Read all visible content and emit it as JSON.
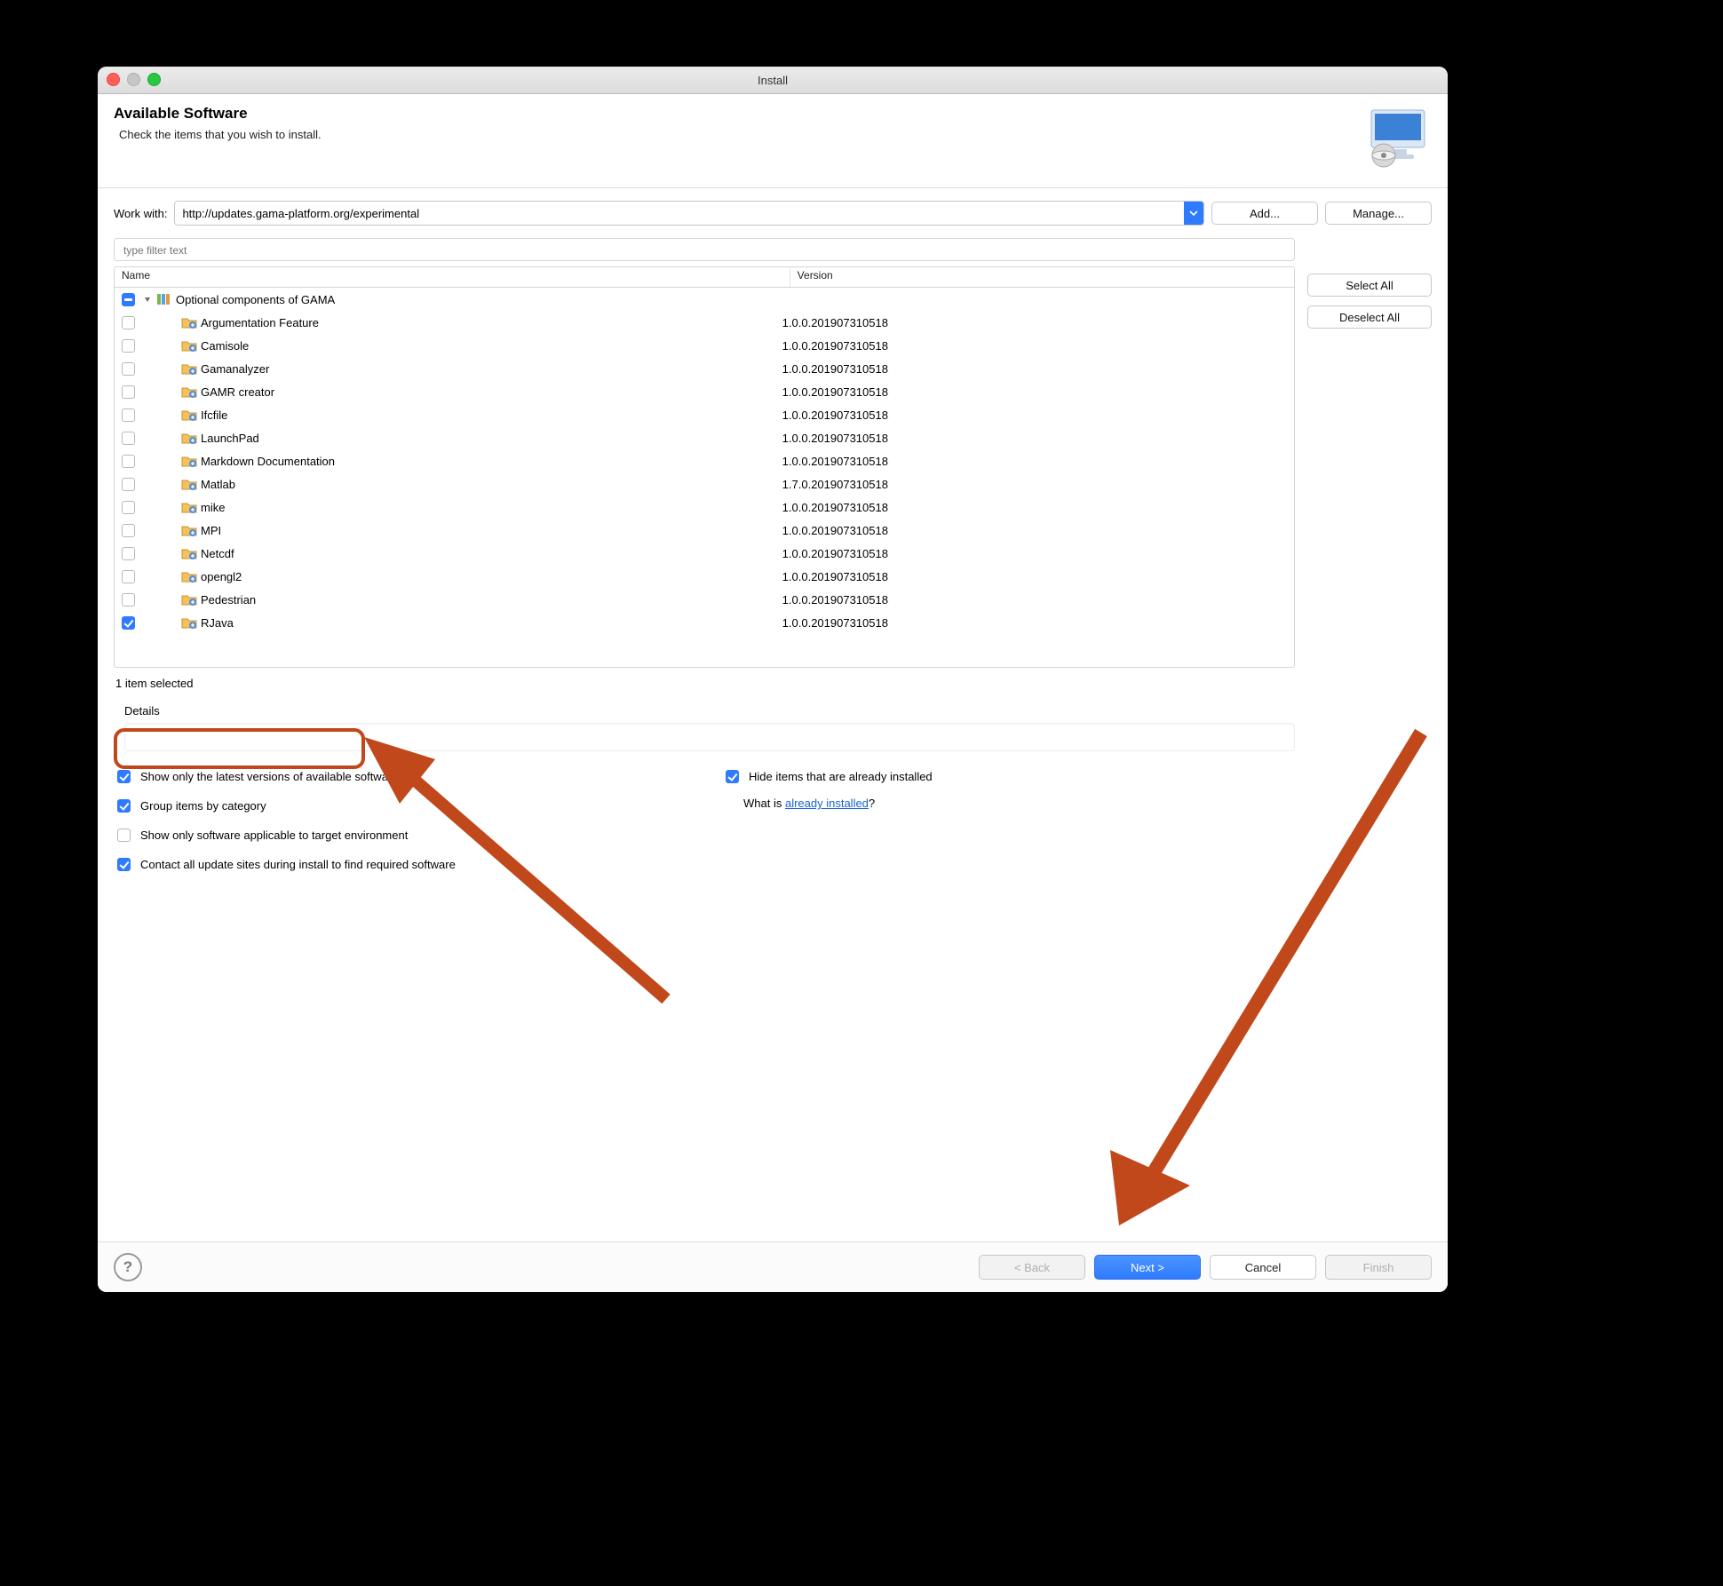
{
  "title": "Install",
  "header": {
    "heading": "Available Software",
    "sub": "Check the items that you wish to install."
  },
  "workwith": {
    "label": "Work with:",
    "value": "http://updates.gama-platform.org/experimental",
    "add": "Add...",
    "manage": "Manage..."
  },
  "filter_placeholder": "type filter text",
  "columns": {
    "name": "Name",
    "version": "Version"
  },
  "side": {
    "select_all": "Select All",
    "deselect_all": "Deselect All"
  },
  "category": {
    "label": "Optional components of GAMA"
  },
  "items": [
    {
      "name": "Argumentation Feature",
      "version": "1.0.0.201907310518",
      "checked": false
    },
    {
      "name": "Camisole",
      "version": "1.0.0.201907310518",
      "checked": false
    },
    {
      "name": "Gamanalyzer",
      "version": "1.0.0.201907310518",
      "checked": false
    },
    {
      "name": "GAMR creator",
      "version": "1.0.0.201907310518",
      "checked": false
    },
    {
      "name": "Ifcfile",
      "version": "1.0.0.201907310518",
      "checked": false
    },
    {
      "name": "LaunchPad",
      "version": "1.0.0.201907310518",
      "checked": false
    },
    {
      "name": "Markdown Documentation",
      "version": "1.0.0.201907310518",
      "checked": false
    },
    {
      "name": "Matlab",
      "version": "1.7.0.201907310518",
      "checked": false
    },
    {
      "name": "mike",
      "version": "1.0.0.201907310518",
      "checked": false
    },
    {
      "name": "MPI",
      "version": "1.0.0.201907310518",
      "checked": false
    },
    {
      "name": "Netcdf",
      "version": "1.0.0.201907310518",
      "checked": false
    },
    {
      "name": "opengl2",
      "version": "1.0.0.201907310518",
      "checked": false
    },
    {
      "name": "Pedestrian",
      "version": "1.0.0.201907310518",
      "checked": false
    },
    {
      "name": "RJava",
      "version": "1.0.0.201907310518",
      "checked": true
    }
  ],
  "status": "1 item selected",
  "details_label": "Details",
  "options": {
    "latest": "Show only the latest versions of available software",
    "group": "Group items by category",
    "applicable": "Show only software applicable to target environment",
    "contact": "Contact all update sites during install to find required software",
    "hide": "Hide items that are already installed",
    "whatis_prefix": "What is ",
    "whatis_link": "already installed",
    "whatis_suffix": "?"
  },
  "footer": {
    "back": "< Back",
    "next": "Next >",
    "cancel": "Cancel",
    "finish": "Finish"
  }
}
